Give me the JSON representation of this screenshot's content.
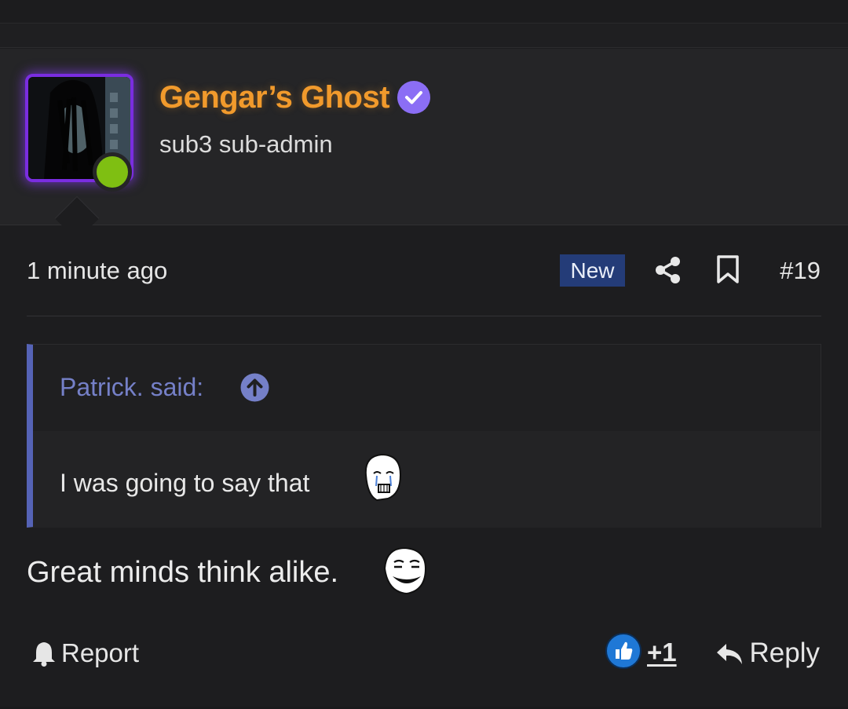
{
  "post": {
    "author": {
      "username": "Gengar’s Ghost",
      "title": "sub3 sub-admin",
      "verified_icon": "verified-badge-icon",
      "online": true,
      "colors": {
        "username": "#f19a2c",
        "avatar_glow": "#7a2de0",
        "online": "#7fbf12",
        "verified": "#8b6ef5"
      }
    },
    "meta": {
      "timestamp": "1 minute ago",
      "badge": "New",
      "post_number": "#19",
      "icons": [
        "share-icon",
        "bookmark-icon"
      ]
    },
    "quote": {
      "author_label": "Patrick. said:",
      "jump_icon": "arrow-up-circle-icon",
      "text": "I was going to say that",
      "emoji": "wojak-crying-emoji"
    },
    "message": {
      "text": "Great minds think alike.",
      "emoji": "wojak-smiling-emoji"
    },
    "actions": {
      "report_label": "Report",
      "like_count": "+1",
      "reply_label": "Reply"
    }
  }
}
